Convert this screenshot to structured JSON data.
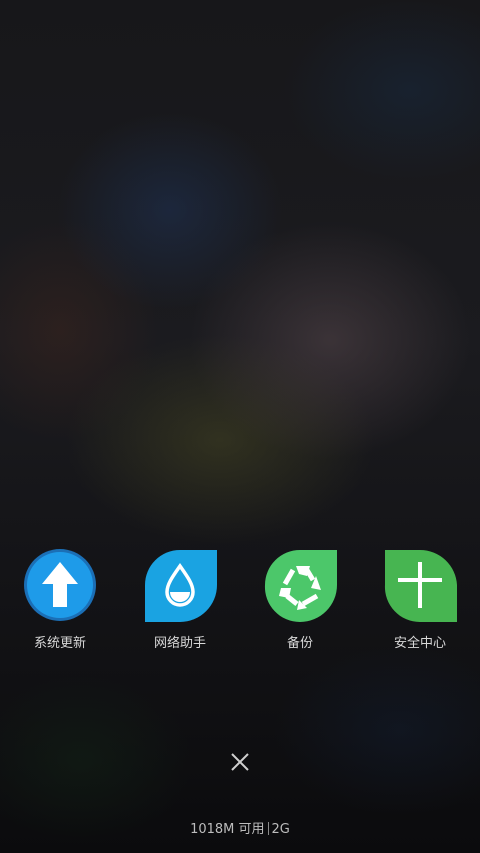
{
  "apps": [
    {
      "label": "系统更新",
      "icon": "arrow-up-icon",
      "color": "#1e9be9"
    },
    {
      "label": "网络助手",
      "icon": "water-drop-icon",
      "color": "#1aa3e2"
    },
    {
      "label": "备份",
      "icon": "recycle-icon",
      "color": "#4cc76a"
    },
    {
      "label": "安全中心",
      "icon": "plus-icon",
      "color": "#47b551"
    }
  ],
  "status": {
    "memory": "1018M 可用",
    "network": "2G"
  },
  "close_icon": "close-icon"
}
